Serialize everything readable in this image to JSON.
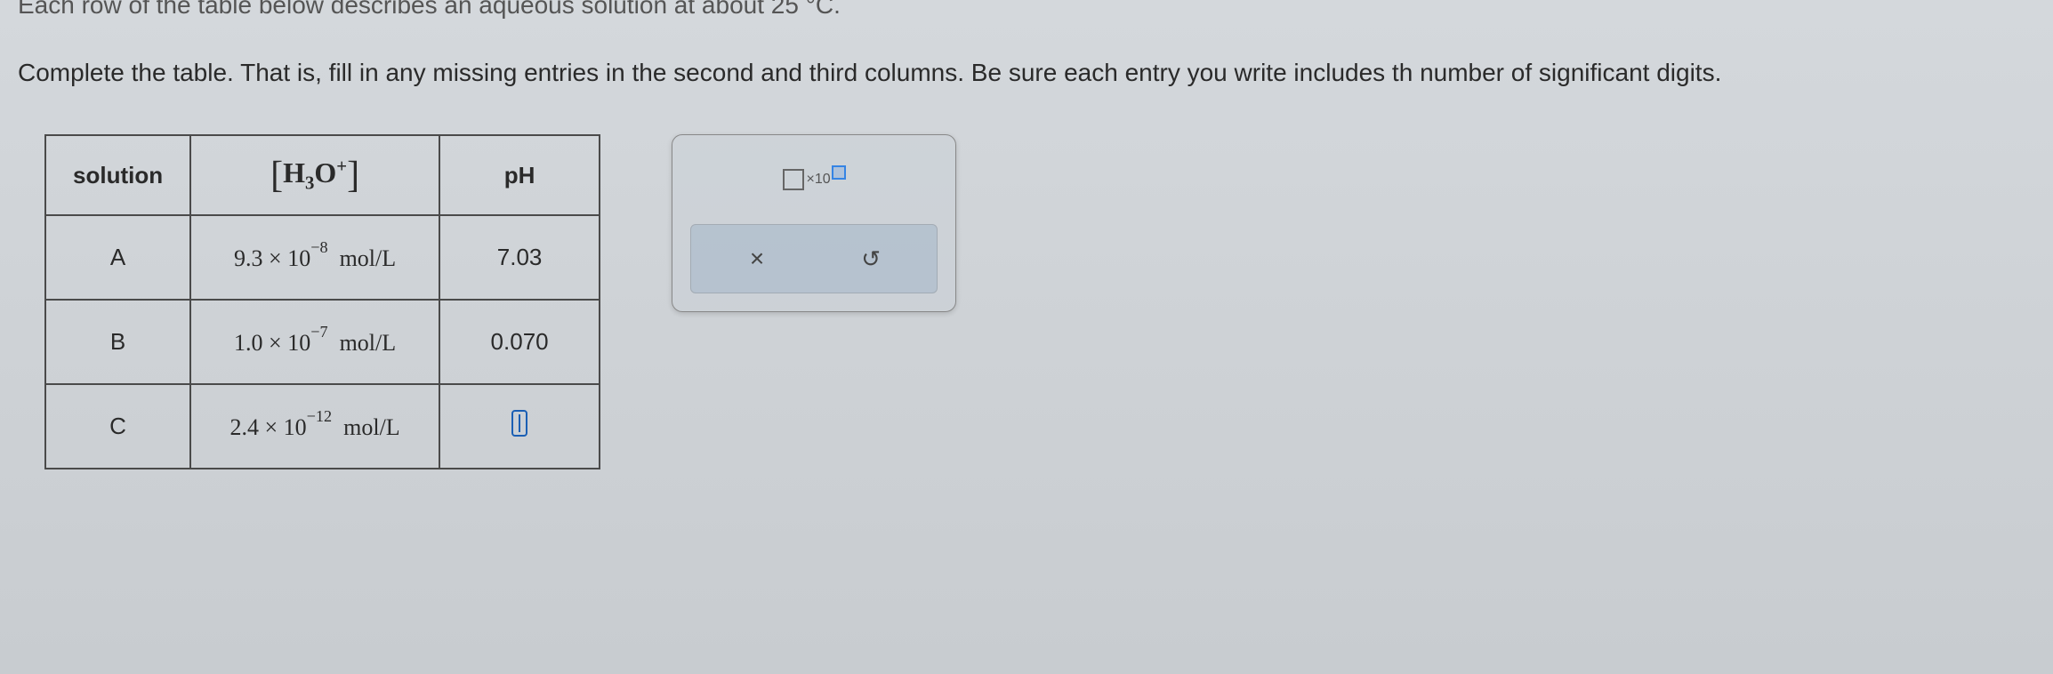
{
  "cutoff_text": "Each row of the table below describes an aqueous solution at about 25 °C.",
  "instruction": "Complete the table. That is, fill in any missing entries in the second and third columns. Be sure each entry you write includes th\nnumber of significant digits.",
  "table": {
    "headers": {
      "solution": "solution",
      "h3o": "H₃O⁺",
      "ph": "pH"
    },
    "rows": [
      {
        "solution": "A",
        "coefficient": "9.3",
        "exponent": "−8",
        "unit": "mol/L",
        "ph": "7.03"
      },
      {
        "solution": "B",
        "coefficient": "1.0",
        "exponent": "−7",
        "unit": "mol/L",
        "ph": "0.070"
      },
      {
        "solution": "C",
        "coefficient": "2.4",
        "exponent": "−12",
        "unit": "mol/L",
        "ph": ""
      }
    ]
  },
  "toolpanel": {
    "sci_label": "×10",
    "clear_symbol": "×",
    "reset_symbol": "↺"
  }
}
